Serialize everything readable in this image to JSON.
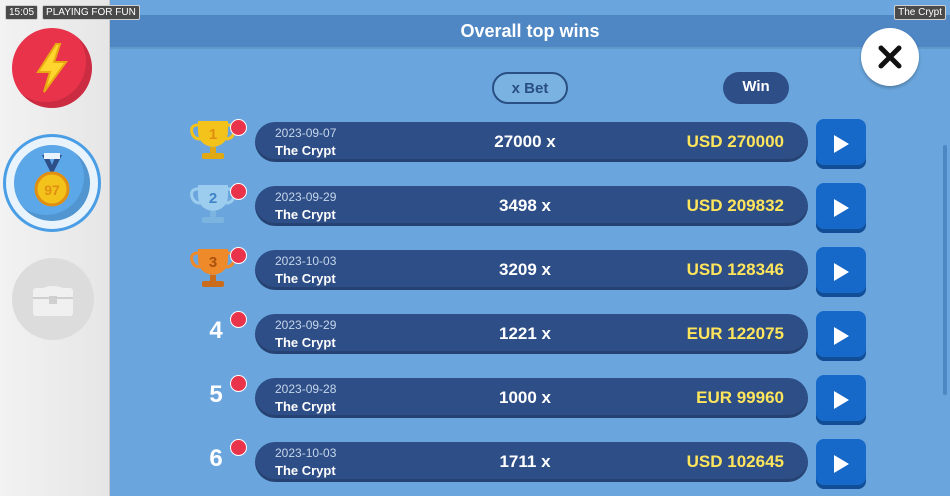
{
  "status": {
    "time": "15:05",
    "mode": "PLAYING FOR FUN",
    "game": "The Crypt"
  },
  "sidebar": {
    "items": [
      {
        "name": "bolt",
        "icon": "lightning-icon"
      },
      {
        "name": "medal",
        "icon": "medal-icon",
        "medal_text": "97"
      },
      {
        "name": "chest",
        "icon": "chest-icon"
      }
    ]
  },
  "header": {
    "title": "Overall top wins"
  },
  "columns": {
    "bet": "x Bet",
    "win": "Win"
  },
  "rows": [
    {
      "rank": "1",
      "date": "2023-09-07",
      "game": "The Crypt",
      "multiplier": "27000 x",
      "win": "USD 270000"
    },
    {
      "rank": "2",
      "date": "2023-09-29",
      "game": "The Crypt",
      "multiplier": "3498 x",
      "win": "USD 209832"
    },
    {
      "rank": "3",
      "date": "2023-10-03",
      "game": "The Crypt",
      "multiplier": "3209 x",
      "win": "USD 128346"
    },
    {
      "rank": "4",
      "date": "2023-09-29",
      "game": "The Crypt",
      "multiplier": "1221 x",
      "win": "EUR 122075"
    },
    {
      "rank": "5",
      "date": "2023-09-28",
      "game": "The Crypt",
      "multiplier": "1000 x",
      "win": "EUR 99960"
    },
    {
      "rank": "6",
      "date": "2023-10-03",
      "game": "The Crypt",
      "multiplier": "1711 x",
      "win": "USD 102645"
    }
  ],
  "colors": {
    "gold": "#f3c21b",
    "silver": "#9ccdee",
    "bronze": "#ee8a2a",
    "accent": "#1769c9"
  }
}
